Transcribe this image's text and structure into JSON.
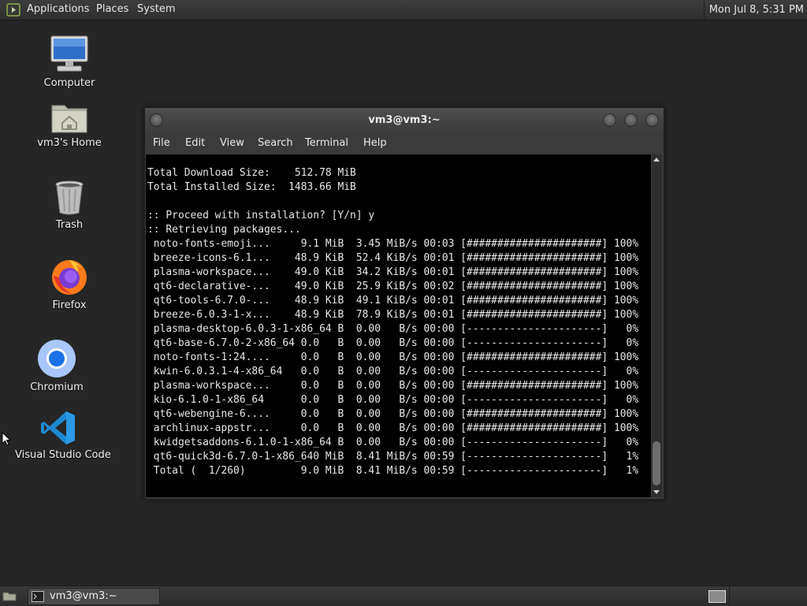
{
  "top_panel": {
    "menus": [
      "Applications",
      "Places",
      "System"
    ],
    "clock": "Mon Jul  8,  5:31 PM"
  },
  "desktop_icons": [
    {
      "label": "Computer",
      "icon": "computer-icon"
    },
    {
      "label": "vm3's Home",
      "icon": "home-folder-icon"
    },
    {
      "label": "Trash",
      "icon": "trash-icon"
    },
    {
      "label": "Firefox",
      "icon": "firefox-icon"
    },
    {
      "label": "Chromium",
      "icon": "chromium-icon"
    },
    {
      "label": "Visual Studio Code",
      "icon": "vscode-icon"
    }
  ],
  "terminal": {
    "title": "vm3@vm3:~",
    "menu": [
      "File",
      "Edit",
      "View",
      "Search",
      "Terminal",
      "Help"
    ],
    "lines": [
      "Total Download Size:    512.78 MiB",
      "Total Installed Size:  1483.66 MiB",
      "",
      ":: Proceed with installation? [Y/n] y",
      ":: Retrieving packages...",
      " noto-fonts-emoji...     9.1 MiB  3.45 MiB/s 00:03 [######################] 100%",
      " breeze-icons-6.1...    48.9 KiB  52.4 KiB/s 00:01 [######################] 100%",
      " plasma-workspace...    49.0 KiB  34.2 KiB/s 00:01 [######################] 100%",
      " qt6-declarative-...    49.0 KiB  25.9 KiB/s 00:02 [######################] 100%",
      " qt6-tools-6.7.0-...    48.9 KiB  49.1 KiB/s 00:01 [######################] 100%",
      " breeze-6.0.3-1-x...    48.9 KiB  78.9 KiB/s 00:01 [######################] 100%",
      " plasma-desktop-6.0.3-1-x86_64 B  0.00   B/s 00:00 [----------------------]   0%",
      " qt6-base-6.7.0-2-x86_64 0.0   B  0.00   B/s 00:00 [----------------------]   0%",
      " noto-fonts-1:24....     0.0   B  0.00   B/s 00:00 [######################] 100%",
      " kwin-6.0.3.1-4-x86_64   0.0   B  0.00   B/s 00:00 [----------------------]   0%",
      " plasma-workspace...     0.0   B  0.00   B/s 00:00 [######################] 100%",
      " kio-6.1.0-1-x86_64      0.0   B  0.00   B/s 00:00 [----------------------]   0%",
      " qt6-webengine-6....     0.0   B  0.00   B/s 00:00 [######################] 100%",
      " archlinux-appstr...     0.0   B  0.00   B/s 00:00 [######################] 100%",
      " kwidgetsaddons-6.1.0-1-x86_64 B  0.00   B/s 00:00 [----------------------]   0%",
      " qt6-quick3d-6.7.0-1-x86_640 MiB  8.41 MiB/s 00:59 [----------------------]   1%",
      " Total (  1/260)         9.0 MiB  8.41 MiB/s 00:59 [----------------------]   1%"
    ]
  },
  "taskbar": {
    "tasks": [
      {
        "label": "vm3@vm3:~"
      }
    ]
  }
}
